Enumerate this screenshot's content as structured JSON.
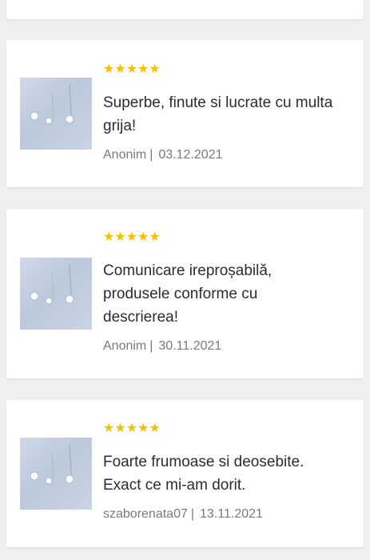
{
  "colors": {
    "background": "#efefef",
    "card": "#ffffff",
    "star": "#f2c200",
    "text": "#2c2c2c",
    "meta": "#7a7a7a"
  },
  "reviews": [
    {
      "stars": "★★★★★",
      "rating": 5,
      "text": "Superbe, finute si lucrate cu multa grija!",
      "author": "Anonim",
      "separator": "|",
      "date": "03.12.2021",
      "image_icon": "earrings-photo"
    },
    {
      "stars": "★★★★★",
      "rating": 5,
      "text": "Comunicare ireproșabilă, produsele conforme cu descrierea!",
      "author": "Anonim",
      "separator": "|",
      "date": "30.11.2021",
      "image_icon": "earrings-photo"
    },
    {
      "stars": "★★★★★",
      "rating": 5,
      "text": "Foarte frumoase si deosebite. Exact ce mi-am dorit.",
      "author": "szaborenata07",
      "separator": "|",
      "date": "13.11.2021",
      "image_icon": "earrings-photo"
    }
  ]
}
